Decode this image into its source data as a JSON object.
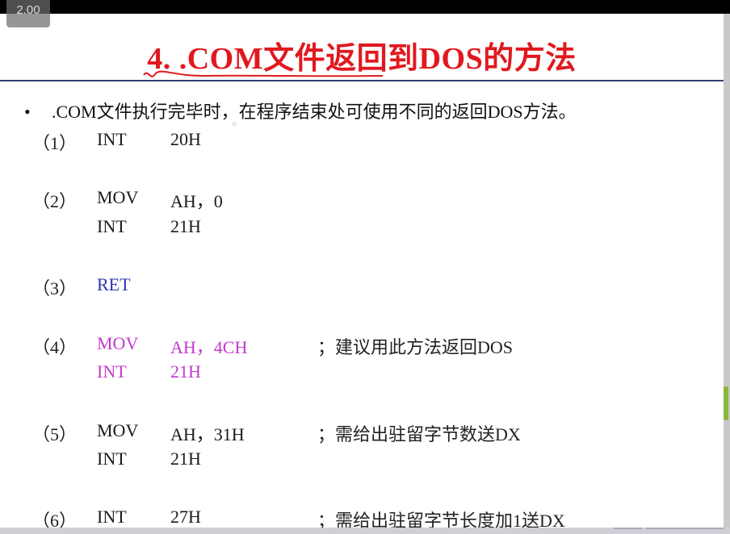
{
  "player": {
    "speed_label": "2.00"
  },
  "slide": {
    "title": "4. .COM文件返回到DOS的方法",
    "bullet": ".COM文件执行完毕时，在程序结束处可使用不同的返回DOS方法。",
    "cursor_mark": "⁘",
    "rows": [
      {
        "num": "（1）",
        "op": "INT",
        "arg": "20H",
        "comment": "",
        "color": "#1b1b1b"
      },
      {
        "num": "（2）",
        "op": "MOV",
        "arg": "AH，0",
        "comment": "",
        "color": "#1b1b1b"
      },
      {
        "num": "",
        "op": "INT",
        "arg": "21H",
        "comment": "",
        "color": "#1b1b1b"
      },
      {
        "num": "（3）",
        "op": "RET",
        "arg": "",
        "comment": "",
        "color": "#3333b8"
      },
      {
        "num": "（4）",
        "op": "MOV",
        "arg": "AH，4CH",
        "comment": "；建议用此方法返回DOS",
        "color": "#c43ad0"
      },
      {
        "num": "",
        "op": "INT",
        "arg": "21H",
        "comment": "",
        "color": "#c43ad0"
      },
      {
        "num": "（5）",
        "op": "MOV",
        "arg": "AH，31H",
        "comment": "；需给出驻留字节数送DX",
        "color": "#1b1b1b"
      },
      {
        "num": "",
        "op": "INT",
        "arg": "21H",
        "comment": "",
        "color": "#1b1b1b"
      },
      {
        "num": "（6）",
        "op": "INT",
        "arg": "27H",
        "comment": "；需给出驻留字节长度加1送DX",
        "color": "#1b1b1b"
      }
    ]
  },
  "colors": {
    "title": "#e0191f",
    "rule": "#2f3f6e",
    "scroll_thumb": "#8ab83a"
  }
}
